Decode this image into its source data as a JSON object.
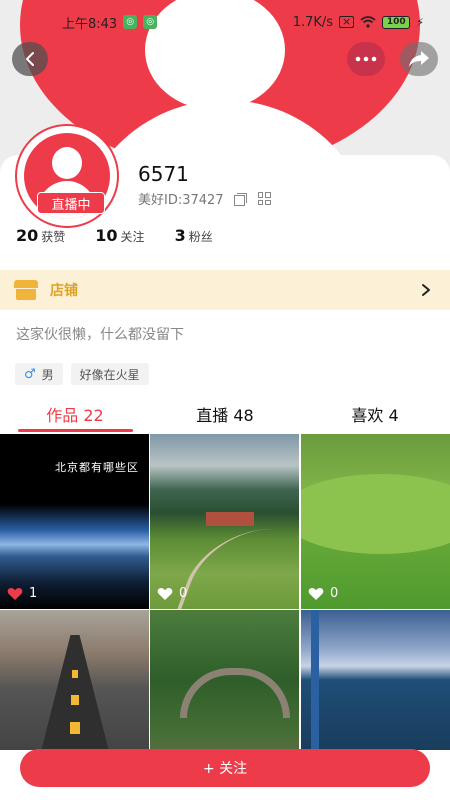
{
  "status_bar": {
    "time": "上午8:43",
    "network_speed": "1.7K/s",
    "battery": "100"
  },
  "profile": {
    "username": "6571",
    "id_text": "美好ID:37427",
    "live_badge": "直播中",
    "stats": [
      {
        "num": "20",
        "label": "获赞"
      },
      {
        "num": "10",
        "label": "关注"
      },
      {
        "num": "3",
        "label": "粉丝"
      }
    ],
    "bio": "这家伙很懒，什么都没留下",
    "tags": [
      {
        "icon": "male-icon",
        "label": "男"
      },
      {
        "label": "好像在火星"
      }
    ]
  },
  "shop": {
    "label": "店铺"
  },
  "tabs": [
    {
      "label": "作品 22",
      "active": true
    },
    {
      "label": "直播 48",
      "active": false
    },
    {
      "label": "喜欢 4",
      "active": false
    }
  ],
  "grid": [
    {
      "caption": "北京都有哪些区",
      "likes": "1",
      "heart_color": "#ee3b4a"
    },
    {
      "likes": "0",
      "heart_color": "#ffffff"
    },
    {
      "likes": "0",
      "heart_color": "#ffffff"
    },
    {},
    {},
    {}
  ],
  "follow_button": {
    "label": "+ 关注"
  },
  "colors": {
    "accent": "#ee3b4a",
    "shop_bg": "#fcf1d6",
    "shop_text": "#e0a424"
  }
}
